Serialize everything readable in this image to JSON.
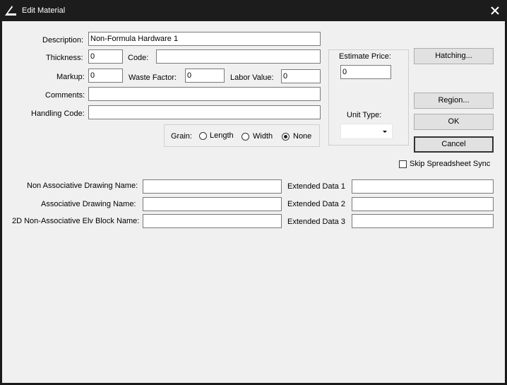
{
  "window": {
    "title": "Edit Material",
    "app_icon": "app-logo-icon",
    "close_icon": "close-icon"
  },
  "form": {
    "description": {
      "label": "Description:",
      "value": "Non-Formula Hardware 1"
    },
    "thickness": {
      "label": "Thickness:",
      "value": "0"
    },
    "code": {
      "label": "Code:",
      "value": ""
    },
    "markup": {
      "label": "Markup:",
      "value": "0"
    },
    "waste_factor": {
      "label": "Waste Factor:",
      "value": "0"
    },
    "labor_value": {
      "label": "Labor Value:",
      "value": "0"
    },
    "comments": {
      "label": "Comments:",
      "value": ""
    },
    "handling_code": {
      "label": "Handling Code:",
      "value": ""
    },
    "grain": {
      "label": "Grain:",
      "options": [
        "Length",
        "Width",
        "None"
      ],
      "selected": "None"
    }
  },
  "pricing": {
    "estimate_price": {
      "label": "Estimate Price:",
      "value": "0"
    },
    "unit_type": {
      "label": "Unit Type:",
      "value": ""
    }
  },
  "buttons": {
    "hatching": "Hatching...",
    "region": "Region...",
    "ok": "OK",
    "cancel": "Cancel"
  },
  "skip_sync": {
    "label": "Skip Spreadsheet Sync",
    "checked": false
  },
  "drawing": {
    "non_assoc_name": {
      "label": "Non Associative Drawing Name:",
      "value": ""
    },
    "assoc_name": {
      "label": "Associative Drawing Name:",
      "value": ""
    },
    "elv_block_name": {
      "label": "2D Non-Associative Elv Block Name:",
      "value": ""
    }
  },
  "extended": {
    "data1": {
      "label": "Extended Data 1",
      "value": ""
    },
    "data2": {
      "label": "Extended Data 2",
      "value": ""
    },
    "data3": {
      "label": "Extended Data 3",
      "value": ""
    }
  },
  "colors": {
    "titlebar": "#1c1c1c",
    "client": "#f0f0f0",
    "button": "#e1e1e1"
  }
}
